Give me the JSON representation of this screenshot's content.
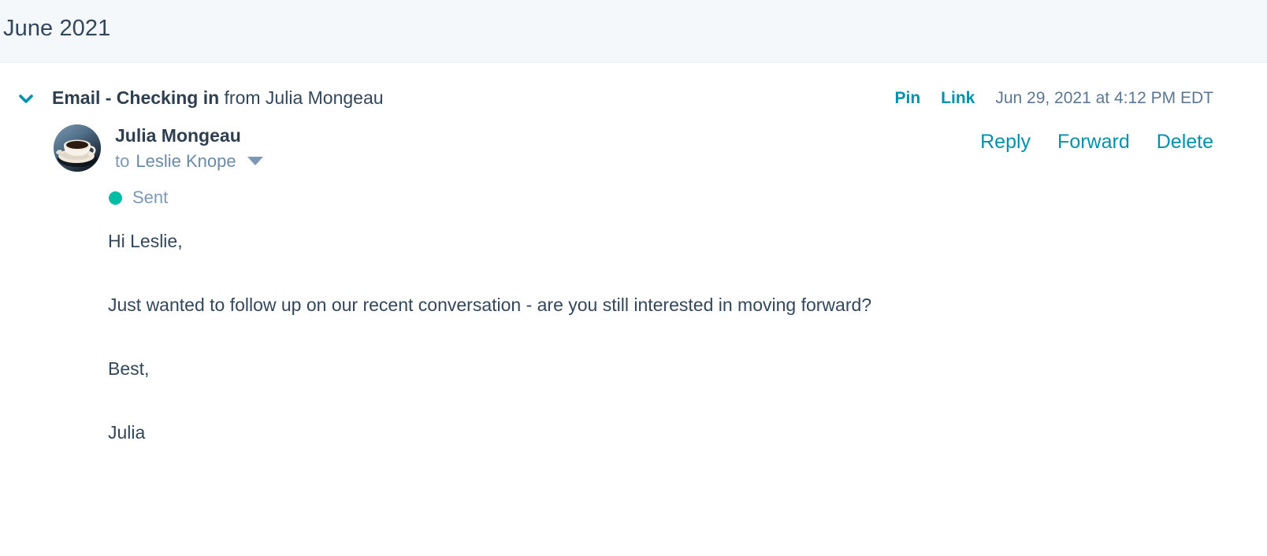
{
  "month_header": {
    "label": "June 2021"
  },
  "activity": {
    "toggle_icon": "chevron-down-icon",
    "title_strong": "Email - Checking in",
    "title_rest": " from Julia Mongeau",
    "header_actions": {
      "pin_label": "Pin",
      "link_label": "Link"
    },
    "timestamp": "Jun 29, 2021 at 4:12 PM EDT",
    "sender": {
      "avatar_icon": "coffee-cup-avatar",
      "name": "Julia Mongeau",
      "to_word": "to",
      "recipient": "Leslie Knope",
      "recipient_caret_icon": "caret-down-icon"
    },
    "actions": {
      "reply_label": "Reply",
      "forward_label": "Forward",
      "delete_label": "Delete"
    },
    "status": {
      "dot_icon": "status-dot-icon",
      "label": "Sent"
    },
    "body": {
      "greeting": "Hi Leslie,",
      "paragraph": "Just wanted to follow up on our recent conversation - are you still interested in moving forward?",
      "closing": "Best,",
      "signature": "Julia"
    }
  },
  "colors": {
    "accent_teal": "#0091ae",
    "text_navy": "#33475b",
    "muted_blue": "#7c98b6",
    "status_green": "#00bda5",
    "band_bg": "#f5f8fa"
  }
}
